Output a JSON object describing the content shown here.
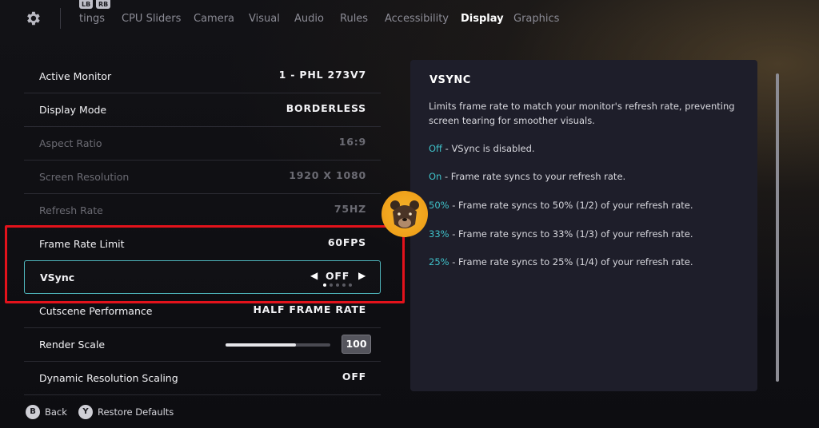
{
  "top_bar": {
    "bumper_left": "LB",
    "bumper_right": "RB",
    "tabs": [
      {
        "label": "tings"
      },
      {
        "label": "CPU Sliders"
      },
      {
        "label": "Camera"
      },
      {
        "label": "Visual"
      },
      {
        "label": "Audio"
      },
      {
        "label": "Rules"
      },
      {
        "label": "Accessibility"
      },
      {
        "label": "Display",
        "active": true
      },
      {
        "label": "Graphics"
      }
    ],
    "icon": "gear-icon"
  },
  "settings": {
    "active_monitor": {
      "label": "Active Monitor",
      "value": "1 - PHL 273V7"
    },
    "display_mode": {
      "label": "Display Mode",
      "value": "BORDERLESS"
    },
    "aspect_ratio": {
      "label": "Aspect Ratio",
      "value": "16:9",
      "disabled": true
    },
    "screen_resolution": {
      "label": "Screen Resolution",
      "value": "1920 X 1080",
      "disabled": true
    },
    "refresh_rate": {
      "label": "Refresh Rate",
      "value": "75HZ",
      "disabled": true
    },
    "frame_rate_limit": {
      "label": "Frame Rate Limit",
      "value": "60FPS"
    },
    "vsync": {
      "label": "VSync",
      "value": "OFF",
      "option_count": 5,
      "selected_index": 0
    },
    "cutscene_performance": {
      "label": "Cutscene Performance",
      "value": "HALF FRAME RATE"
    },
    "render_scale": {
      "label": "Render Scale",
      "value": "100",
      "fill_fraction": 0.67
    },
    "dynamic_resolution": {
      "label": "Dynamic Resolution Scaling",
      "value": "OFF"
    }
  },
  "info_panel": {
    "title": "VSYNC",
    "description": "Limits frame rate to match your monitor's refresh rate, preventing screen tearing for smoother visuals.",
    "options": [
      {
        "key": "Off",
        "text": " - VSync is disabled."
      },
      {
        "key": "On",
        "text": " - Frame rate syncs to your refresh rate."
      },
      {
        "key": "50%",
        "text": " - Frame rate syncs to 50% (1/2) of your refresh rate."
      },
      {
        "key": "33%",
        "text": " - Frame rate syncs to 33% (1/3) of your refresh rate."
      },
      {
        "key": "25%",
        "text": " - Frame rate syncs to 25% (1/4) of your refresh rate."
      }
    ]
  },
  "footer": {
    "back": {
      "button": "B",
      "label": "Back"
    },
    "restore": {
      "button": "Y",
      "label": "Restore Defaults"
    }
  },
  "colors": {
    "accent": "#3fc0c8",
    "highlight": "#e3121b",
    "panel": "#1e1e2a"
  }
}
